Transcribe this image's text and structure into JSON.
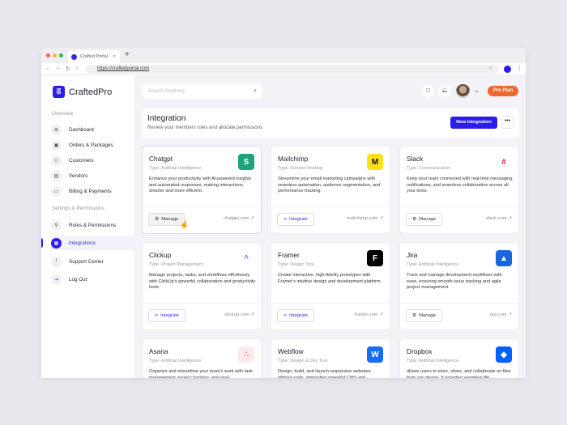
{
  "browser": {
    "tab_title": "Crafted Portal",
    "url": "https://craftedportal.com"
  },
  "sidebar": {
    "brand": "CraftedPro",
    "section_overview": "Overview",
    "section_settings": "Settings & Permissions",
    "items": [
      {
        "label": "Dashboard",
        "icon": "dashboard-icon"
      },
      {
        "label": "Orders & Packages",
        "icon": "package-icon"
      },
      {
        "label": "Customers",
        "icon": "customers-icon"
      },
      {
        "label": "Vendors",
        "icon": "vendors-icon"
      },
      {
        "label": "Billing & Payments",
        "icon": "billing-icon"
      }
    ],
    "settings_items": [
      {
        "label": "Roles & Permissions"
      },
      {
        "label": "Integrations",
        "active": true
      },
      {
        "label": "Support Center"
      },
      {
        "label": "Log Out"
      }
    ]
  },
  "topbar": {
    "search_placeholder": "Search Anything",
    "plan": "Pro Plan"
  },
  "header": {
    "title": "Integration",
    "subtitle": "Review your members roles and allocate permissions",
    "new_button": "New Integration",
    "more": "•••"
  },
  "colors": {
    "accent": "#2a1ee8",
    "plan": "#f0672b"
  },
  "cards": [
    {
      "name": "Chatgpt",
      "type": "Type: Artificial Intelligence",
      "desc": "Enhance your productivity with AI-powered insights and automated responses, making interactions smarter and more efficient.",
      "action": "Manage",
      "link": "chatgpt.com",
      "logo": "S",
      "color": "#1fa37a"
    },
    {
      "name": "Mailchimp",
      "type": "Type: Domain Hosting",
      "desc": "Streamline your email marketing campaigns with seamless automation, audience segmentation, and performance tracking.",
      "action": "Integrate",
      "link": "mailchimp.com",
      "logo": "M",
      "color": "#ffe01b"
    },
    {
      "name": "Slack",
      "type": "Type: Communication",
      "desc": "Keep your team connected with real-time messaging, notifications, and seamless collaboration across all your tools.",
      "action": "Manage",
      "link": "slack.com",
      "logo": "#",
      "color": "#ffffff"
    },
    {
      "name": "Clickup",
      "type": "Type: Project Management",
      "desc": "Manage projects, tasks, and workflows effortlessly with ClickUp's powerful collaboration and productivity tools.",
      "action": "Integrate",
      "link": "clickup.com",
      "logo": "^",
      "color": "#ffffff"
    },
    {
      "name": "Framer",
      "type": "Type: Design Tool",
      "desc": "Create interactive, high-fidelity prototypes with Framer's intuitive design and development platform.",
      "action": "Integrate",
      "link": "framer.com",
      "logo": "F",
      "color": "#000000"
    },
    {
      "name": "Jira",
      "type": "Type: Artificial Intelligence",
      "desc": "Track and manage development workflows with ease, ensuring smooth issue tracking and agile project management.",
      "action": "Manage",
      "link": "jira.com",
      "logo": "▲",
      "color": "#1868db"
    },
    {
      "name": "Asana",
      "type": "Type: Artificial Intelligence",
      "desc": "Organize and streamline your team's work with task management, project tracking, and goal-",
      "action": "",
      "link": "",
      "logo": "∴",
      "color": "#ffe9ea"
    },
    {
      "name": "Webflow",
      "type": "Type: Design & Dev Tool",
      "desc": "Design, build, and launch responsive websites without code, integrating powerful CMS and",
      "action": "",
      "link": "",
      "logo": "W",
      "color": "#146ef5"
    },
    {
      "name": "Dropbox",
      "type": "Type: Artificial Intelligence",
      "desc": "allows users to store, share, and collaborate on files from any device. It provides seamless file",
      "action": "",
      "link": "",
      "logo": "◆",
      "color": "#0061fe"
    }
  ]
}
